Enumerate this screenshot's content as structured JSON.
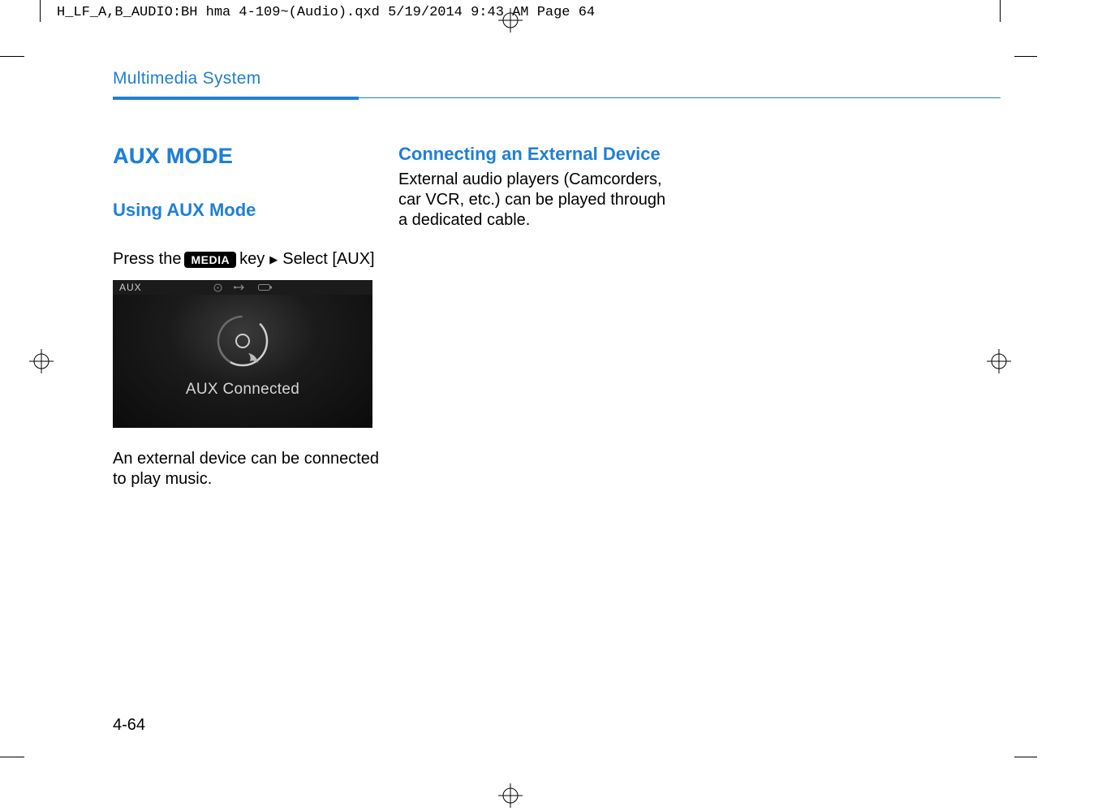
{
  "slug": "H_LF_A,B_AUDIO:BH hma 4-109~(Audio).qxd  5/19/2014  9:43 AM  Page 64",
  "section_title": "Multimedia System",
  "left": {
    "heading": "AUX MODE",
    "subheading": "Using AUX Mode",
    "instruction_pre": "Press the",
    "media_key": "MEDIA",
    "instruction_mid": "key",
    "instruction_post": "Select [AUX]",
    "screenshot": {
      "aux_label": "AUX",
      "status_text": "AUX Connected"
    },
    "body": "An external device can be connected to play music."
  },
  "right": {
    "heading": "Connecting an External Device",
    "body": "External audio players (Camcorders, car VCR, etc.) can be played through a dedicated cable."
  },
  "page_number": "4-64"
}
